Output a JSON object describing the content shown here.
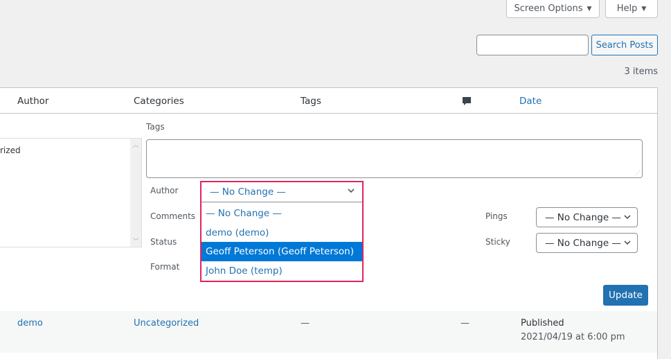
{
  "top_buttons": {
    "screen_options": "Screen Options",
    "help": "Help",
    "caret": "▼"
  },
  "search": {
    "value": "",
    "placeholder": "",
    "button_label": "Search Posts"
  },
  "items_count": "3 items",
  "table": {
    "columns": {
      "author": "Author",
      "categories": "Categories",
      "tags": "Tags",
      "comments_icon": "comment-bubble",
      "date": "Date"
    }
  },
  "bulk_edit": {
    "categories_visible_text": "rized",
    "tags_label": "Tags",
    "tags_value": "",
    "author_label": "Author",
    "comments_label": "Comments",
    "status_label": "Status",
    "format_label": "Format",
    "pings_label": "Pings",
    "sticky_label": "Sticky",
    "author_select": {
      "selected": "— No Change —",
      "options": [
        "— No Change —",
        "demo (demo)",
        "Geoff Peterson (Geoff Peterson)",
        "John Doe (temp)"
      ],
      "highlighted_index": 2
    },
    "pings_select": "— No Change —",
    "sticky_select": "— No Change —",
    "update_button": "Update"
  },
  "rows": [
    {
      "author": "demo",
      "categories": "Uncategorized",
      "tags": "—",
      "comments": "—",
      "date_status": "Published",
      "date": "2021/04/19 at 6:00 pm"
    }
  ],
  "colors": {
    "accent": "#2271b1",
    "highlight_frame": "#e0245e",
    "option_selected": "#0078d7"
  }
}
